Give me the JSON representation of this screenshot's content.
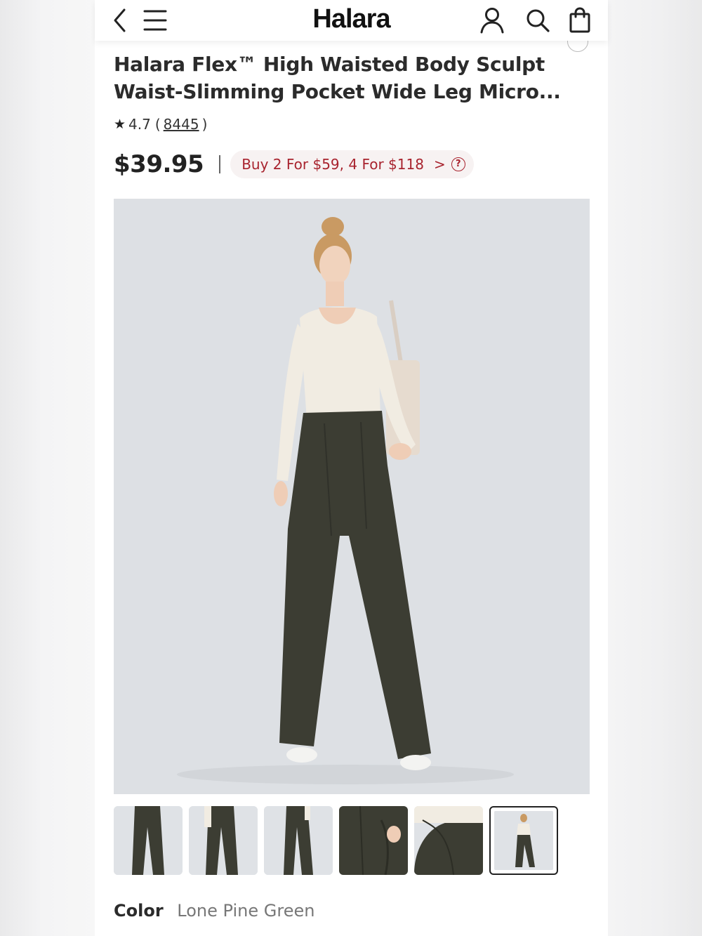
{
  "header": {
    "brand": "Halara",
    "icons": [
      "back-chevron-icon",
      "menu-icon",
      "account-icon",
      "search-icon",
      "shopping-bag-icon"
    ]
  },
  "product": {
    "title_line1": "Halara Flex™ High Waisted Body Sculpt",
    "title_line2": "Waist-Slimming Pocket Wide Leg Micro...",
    "rating": "4.7",
    "rating_open": "(",
    "review_count": "8445",
    "rating_close": ")",
    "price": "$39.95",
    "promo_text": "Buy 2 For $59, 4 For $118",
    "promo_chevron": ">",
    "promo_help": "?"
  },
  "gallery": {
    "thumbnail_count": 6,
    "selected_index": 6
  },
  "color": {
    "label": "Color",
    "value": "Lone Pine Green"
  },
  "colors": {
    "pants": "#3c3d33",
    "top": "#f1ece2",
    "background": "#dde0e4",
    "promo_text": "#a8232e",
    "promo_bg": "#f7f2f2"
  }
}
